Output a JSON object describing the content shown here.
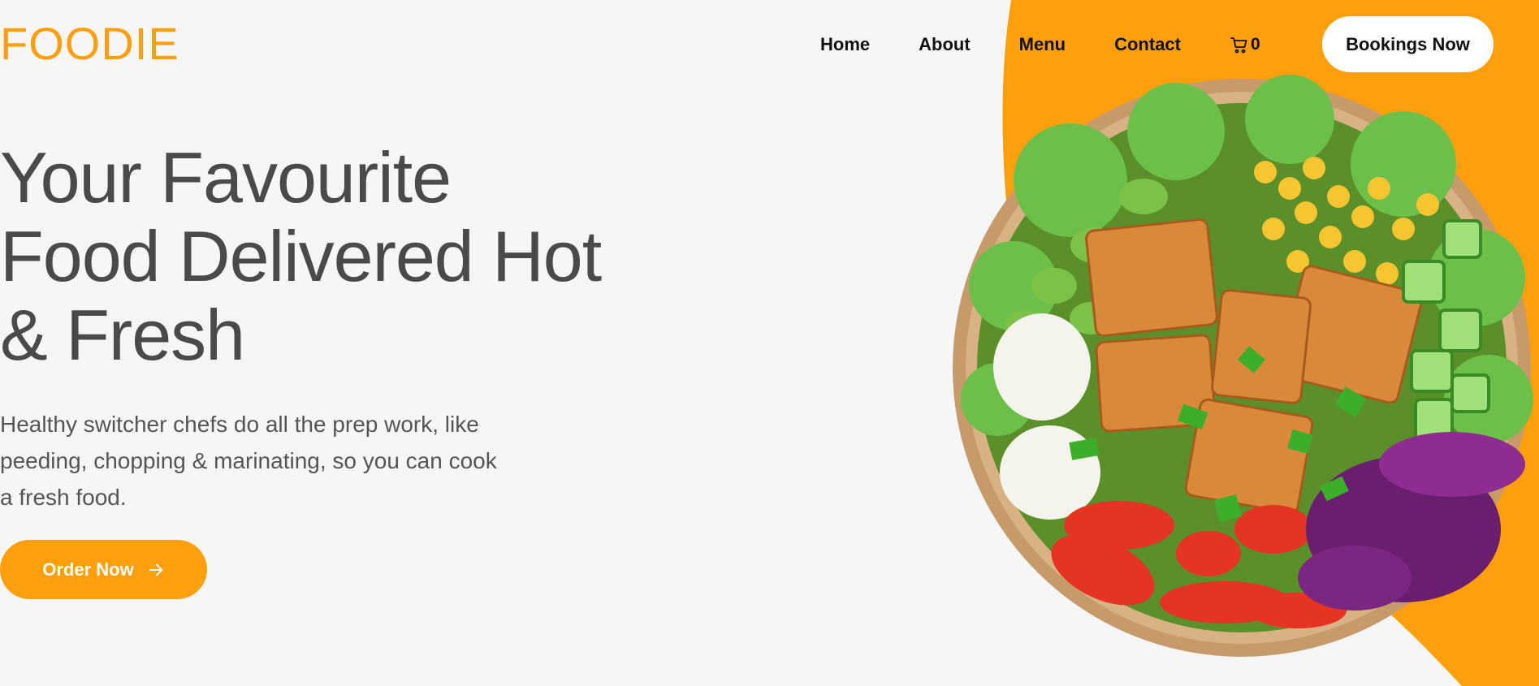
{
  "brand": {
    "logo": "FOODIE",
    "accent": "#FF9F0D"
  },
  "nav": {
    "items": [
      {
        "label": "Home"
      },
      {
        "label": "About"
      },
      {
        "label": "Menu"
      },
      {
        "label": "Contact"
      }
    ],
    "cart_icon": "cart-icon",
    "cart_count": "0",
    "bookings_label": "Bookings Now"
  },
  "hero": {
    "title": "Your Favourite Food Delivered Hot & Fresh",
    "description": "Healthy switcher chefs do all the prep work, like peeding, chopping & marinating, so you can cook a fresh food.",
    "cta_label": "Order Now",
    "cta_icon": "arrow-right-icon",
    "image": "salad-bowl-image"
  },
  "colors": {
    "background": "#F6F6F6",
    "accent": "#FF9F0D",
    "text": "#4A4A4A"
  }
}
